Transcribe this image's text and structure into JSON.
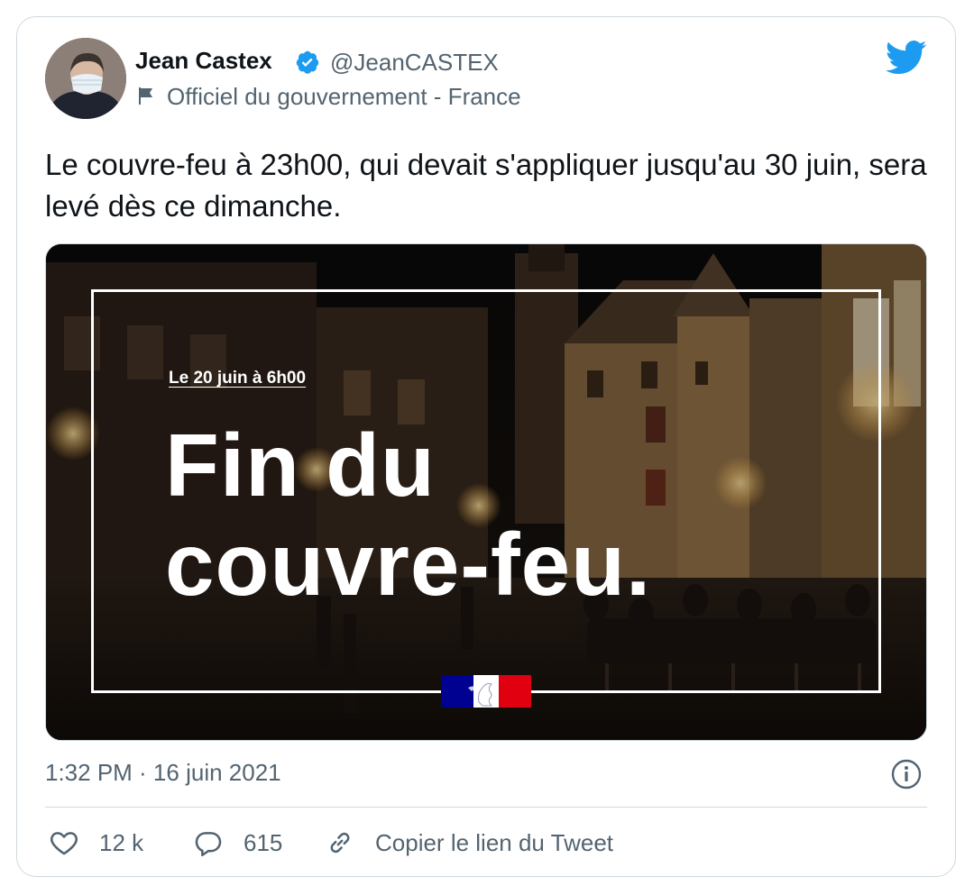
{
  "author": {
    "display_name": "Jean Castex",
    "handle": "@JeanCASTEX",
    "label": "Officiel du gouvernement - France",
    "avatar_icon": "avatar-photo",
    "verified_icon": "verified-badge-icon"
  },
  "tweet": {
    "text": "Le couvre-feu à 23h00, qui devait s'appliquer jusqu'au 30 juin, sera levé dès ce dimanche."
  },
  "media": {
    "subtitle": "Le 20 juin à 6h00",
    "headline_line1": "Fin du",
    "headline_line2": "couvre-feu."
  },
  "meta": {
    "timestamp": "1:32 PM · 16 juin 2021"
  },
  "actions": {
    "likes": "12 k",
    "replies": "615",
    "copy_link": "Copier le lien du Tweet"
  },
  "colors": {
    "brand": "#1d9bf0",
    "text": "#0f1419",
    "secondary": "#536471",
    "border": "#cfd9de",
    "flag_blue": "#000091",
    "flag_red": "#e1000f"
  }
}
